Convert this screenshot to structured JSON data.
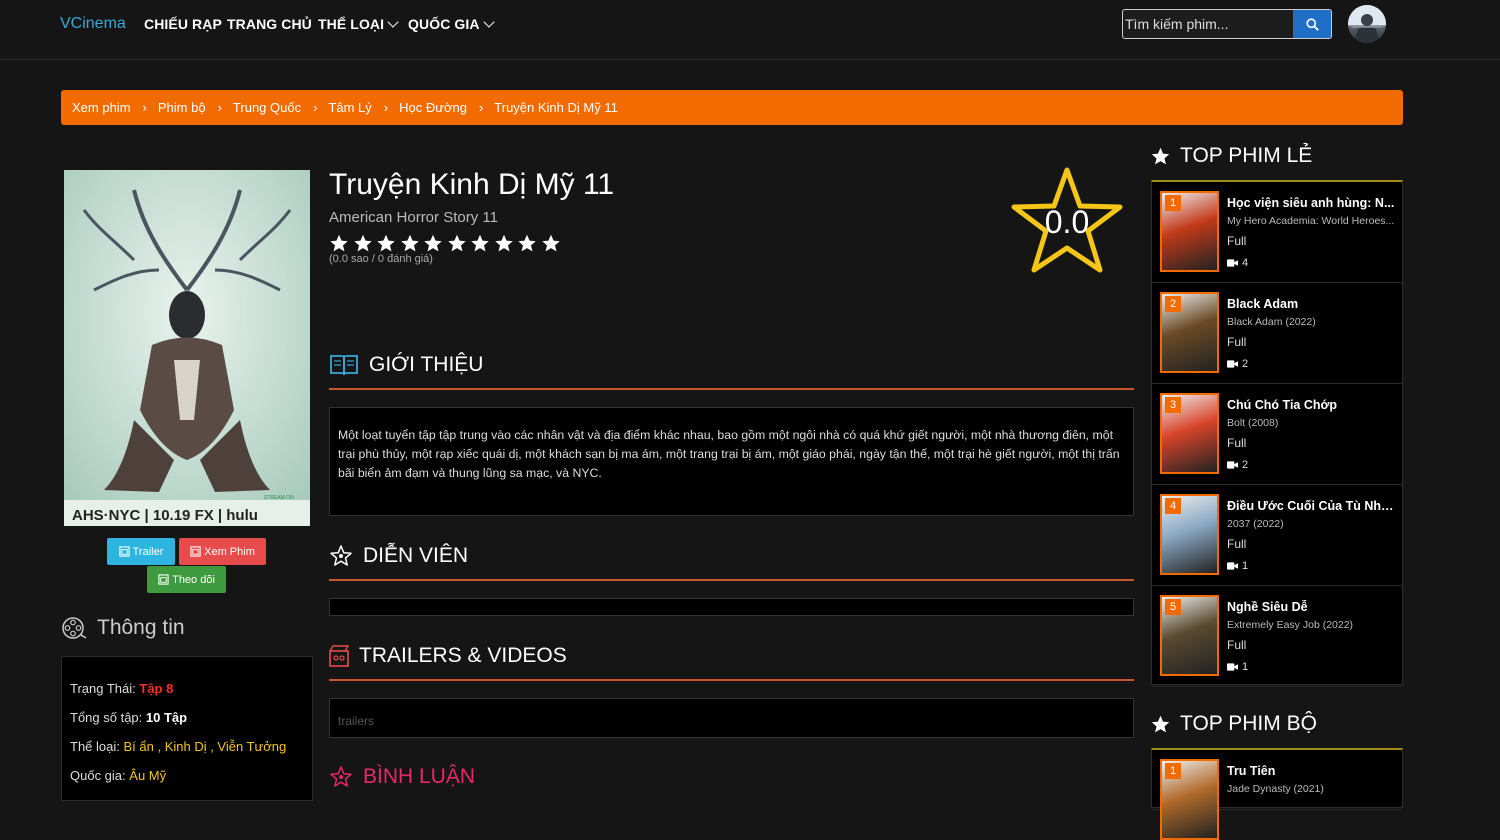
{
  "nav": {
    "brand": "VCinema",
    "items": [
      "CHIẾU RẠP",
      "TRANG CHỦ",
      "THỂ LOẠI",
      "QUỐC GIA"
    ],
    "search_placeholder": "Tìm kiếm phim..."
  },
  "breadcrumb": [
    "Xem phim",
    "Phim bộ",
    "Trung Quốc",
    "Tâm Lý",
    "Học Đường",
    "Truyện Kinh Dị Mỹ 11"
  ],
  "movie": {
    "title": "Truyện Kinh Dị Mỹ 11",
    "original_title": "American Horror Story 11",
    "rating_note": "(0.0 sao / 0 đánh giá)",
    "score": "0.0",
    "star_count": 10,
    "poster_caption": "AHS·NYC | 10.19 FX | hulu",
    "poster_stream": "STREAM ON"
  },
  "buttons": {
    "trailer": "Trailer",
    "watch": "Xem Phim",
    "follow": "Theo dõi"
  },
  "sections": {
    "intro": "GIỚI THIỆU",
    "cast": "DIỄN VIÊN",
    "trailers": "TRAILERS & VIDEOS",
    "comments": "BÌNH LUẬN",
    "info": "Thông tin"
  },
  "description": "Một loạt tuyển tập tập trung vào các nhân vật và địa điểm khác nhau, bao gồm một ngôi nhà có quá khứ giết người, một nhà thương điên, một trại phù thủy, một rạp xiếc quái dị, một khách sạn bị ma ám, một trang trại bị ám, một giáo phái, ngày tận thế, một trại hè giết người, một thị trấn bãi biển ảm đạm và thung lũng sa mạc, và NYC.",
  "trailer_alt": "trailers",
  "info": {
    "status_label": "Trạng Thái:",
    "status_value": "Tập 8",
    "episodes_label": "Tổng số tập:",
    "episodes_value": "10 Tập",
    "genre_label": "Thể loại:",
    "genre_value": "Bí ẩn , Kinh Dị , Viễn Tưởng",
    "country_label": "Quốc gia:",
    "country_value": "Âu Mỹ"
  },
  "top_movies": {
    "heading": "TOP PHIM LẺ",
    "items": [
      {
        "rank": "1",
        "title": "Học viện siêu anh hùng: N...",
        "sub": "My Hero Academia: World Heroes...",
        "status": "Full",
        "eps": "4",
        "color": "#c23a1a"
      },
      {
        "rank": "2",
        "title": "Black Adam",
        "sub": "Black Adam (2022)",
        "status": "Full",
        "eps": "2",
        "color": "#6b4a24"
      },
      {
        "rank": "3",
        "title": "Chú Chó Tia Chớp",
        "sub": "Bolt (2008)",
        "status": "Full",
        "eps": "2",
        "color": "#d8442a"
      },
      {
        "rank": "4",
        "title": "Điều Ước Cuối Của Tù Nhâ...",
        "sub": "2037 (2022)",
        "status": "Full",
        "eps": "1",
        "color": "#8aa8c4"
      },
      {
        "rank": "5",
        "title": "Nghề Siêu Dễ",
        "sub": "Extremely Easy Job (2022)",
        "status": "Full",
        "eps": "1",
        "color": "#5a4a30"
      }
    ]
  },
  "top_series": {
    "heading": "TOP PHIM BỘ",
    "items": [
      {
        "rank": "1",
        "title": "Tru Tiên",
        "sub": "Jade Dynasty (2021)",
        "color": "#b06a2a"
      }
    ]
  }
}
